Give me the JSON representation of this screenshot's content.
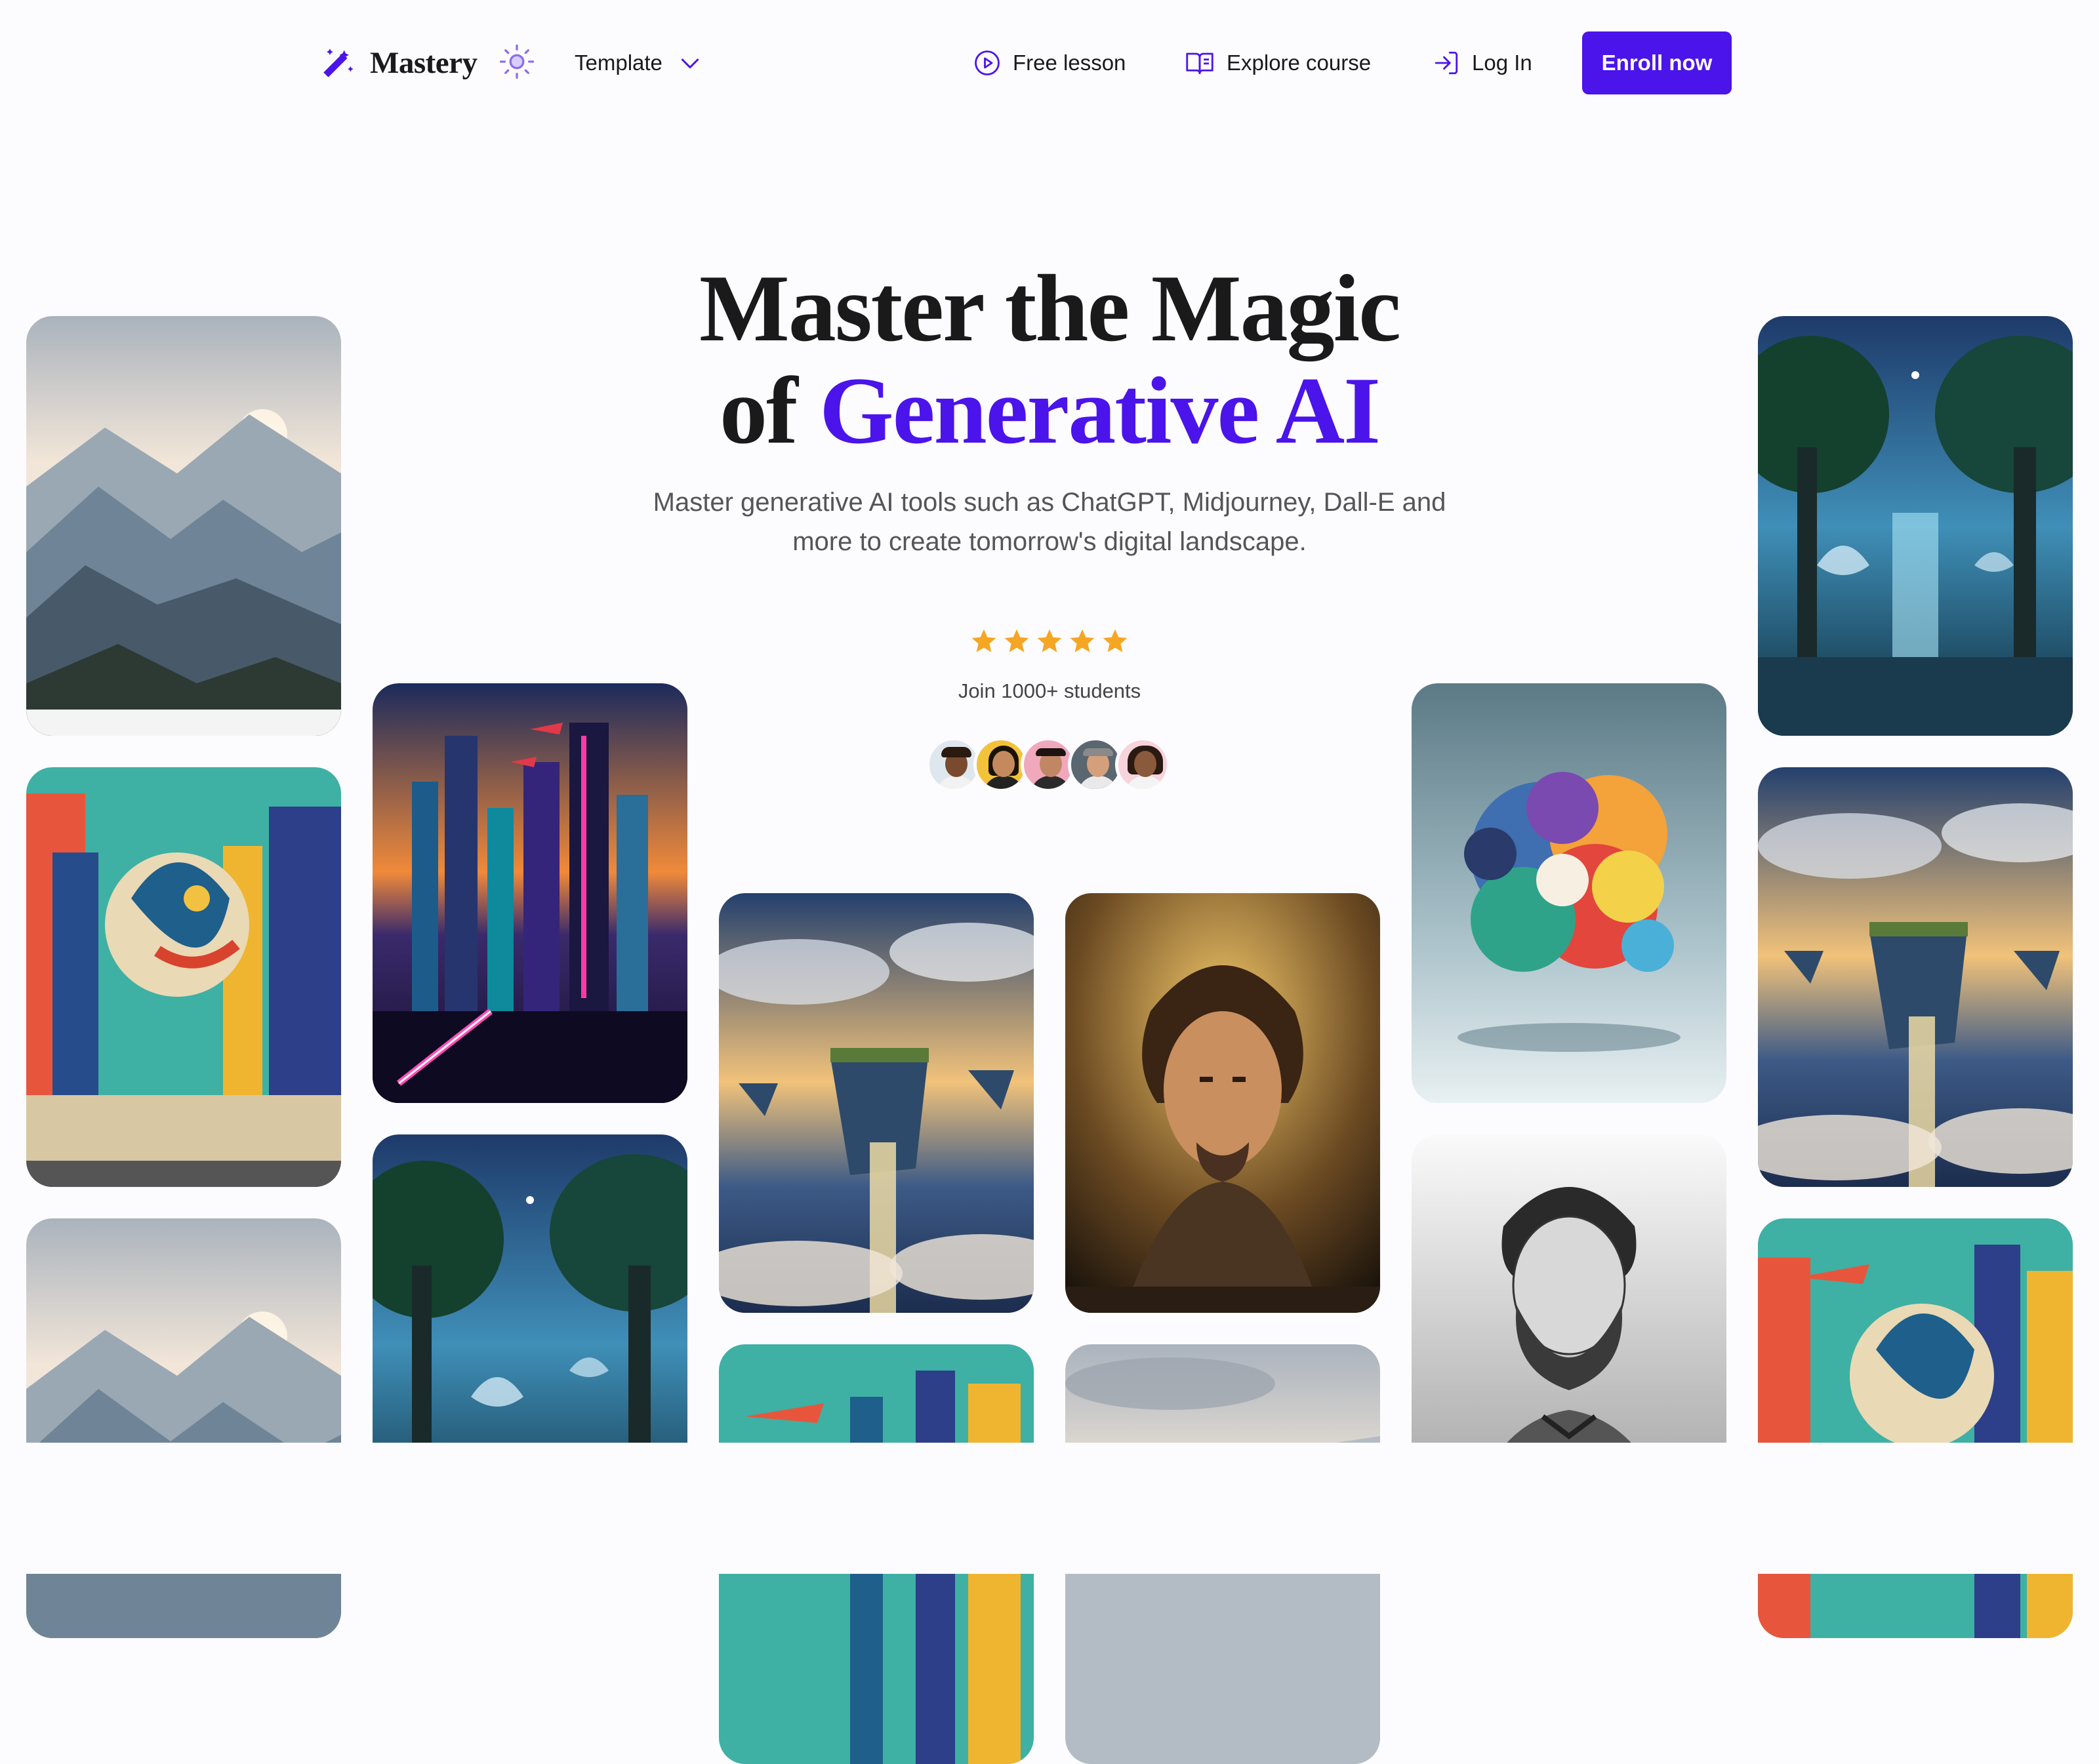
{
  "brand": {
    "name": "Mastery",
    "accent_color": "#4a14ea",
    "logo_icon": "magic-wand-icon"
  },
  "nav": {
    "theme_toggle_icon": "sun-icon",
    "template_label": "Template",
    "free_lesson_label": "Free lesson",
    "explore_course_label": "Explore course",
    "login_label": "Log In",
    "enroll_label": "Enroll now"
  },
  "hero": {
    "title_line1": "Master the Magic",
    "title_line2_prefix": "of",
    "title_line2_accent": "Generative AI",
    "subtitle": "Master generative AI tools such as ChatGPT, Midjourney, Dall-E and more to create tomorrow's digital landscape.",
    "rating_stars": 5,
    "rating_color": "#f5a623",
    "join_text": "Join 1000+ students",
    "student_avatars": [
      "student-1",
      "student-2",
      "student-3",
      "student-4",
      "student-5"
    ]
  },
  "gallery": [
    {
      "name": "misty-mountains-image",
      "scene": "mountains"
    },
    {
      "name": "graffiti-city-mural-image",
      "scene": "mural"
    },
    {
      "name": "misty-mountains-image-2",
      "scene": "mountains"
    },
    {
      "name": "neon-cyberpunk-city-image",
      "scene": "neon-city"
    },
    {
      "name": "enchanted-forest-image",
      "scene": "forest"
    },
    {
      "name": "floating-islands-image",
      "scene": "islands"
    },
    {
      "name": "graffiti-city-mural-image-2",
      "scene": "mural"
    },
    {
      "name": "dramatic-portrait-painting-image",
      "scene": "portrait"
    },
    {
      "name": "misty-mountains-image-3",
      "scene": "mountains"
    },
    {
      "name": "colorful-paint-splash-sculpture-image",
      "scene": "splash"
    },
    {
      "name": "bearded-man-sketch-image",
      "scene": "sketch"
    },
    {
      "name": "enchanted-forest-image-2",
      "scene": "forest"
    },
    {
      "name": "floating-islands-image-2",
      "scene": "islands"
    },
    {
      "name": "graffiti-city-mural-image-3",
      "scene": "mural"
    }
  ]
}
